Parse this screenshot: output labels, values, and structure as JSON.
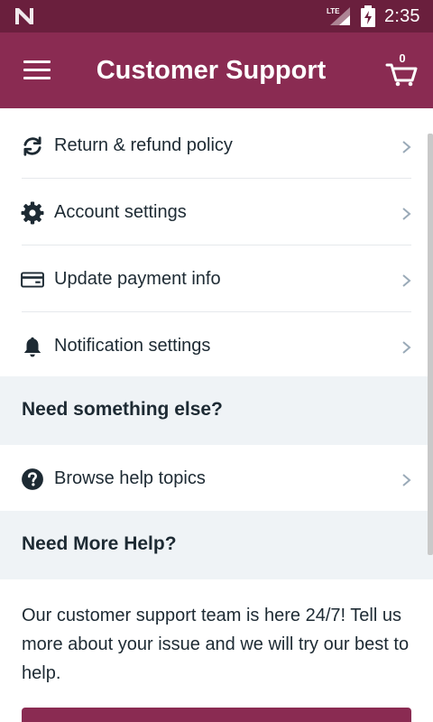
{
  "status_bar": {
    "time": "2:35",
    "network": "LTE"
  },
  "app_bar": {
    "title": "Customer Support",
    "cart_count": "0"
  },
  "menu_items": [
    {
      "label": "Return & refund policy",
      "icon": "refresh-icon"
    },
    {
      "label": "Account settings",
      "icon": "gear-icon"
    },
    {
      "label": "Update payment info",
      "icon": "credit-card-icon"
    },
    {
      "label": "Notification settings",
      "icon": "bell-icon"
    }
  ],
  "sections": {
    "something_else": {
      "title": "Need something else?"
    },
    "more_help": {
      "title": "Need More Help?"
    }
  },
  "help_topics": {
    "label": "Browse help topics",
    "icon": "question-circle-icon"
  },
  "help_text": "Our customer support team is here 24/7! Tell us more about your issue and we will try our best to help.",
  "colors": {
    "status_bar": "#6a1f3d",
    "app_bar": "#8a2b52",
    "section_bg": "#eff3f6",
    "text": "#1d2a33",
    "chevron": "#9aaab8"
  }
}
